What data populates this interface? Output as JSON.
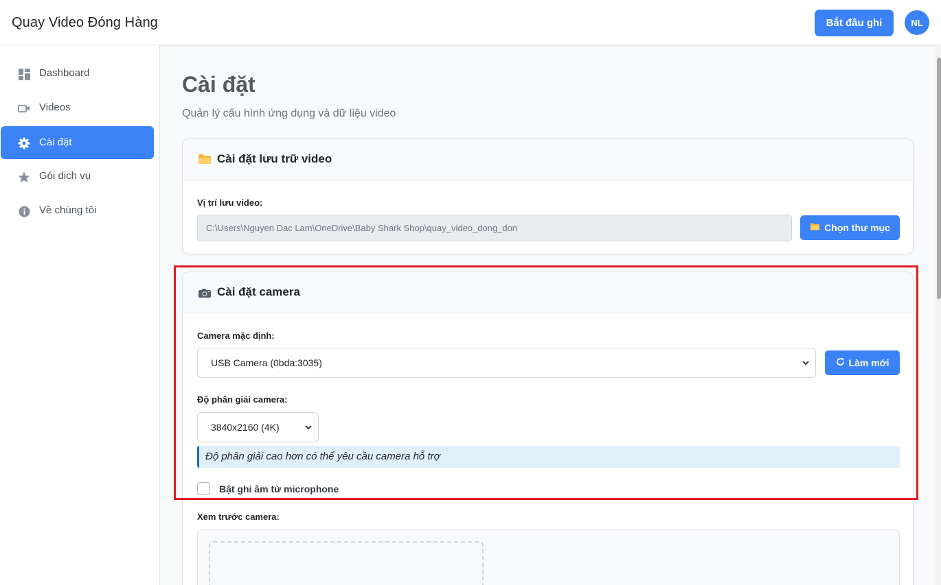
{
  "header": {
    "app_title": "Quay Video Đóng Hàng",
    "record_button": "Bắt đầu ghi",
    "avatar_initials": "NL"
  },
  "sidebar": {
    "items": [
      {
        "label": "Dashboard",
        "icon": "dashboard-icon",
        "active": false
      },
      {
        "label": "Videos",
        "icon": "video-camera-icon",
        "active": false
      },
      {
        "label": "Cài đặt",
        "icon": "gear-icon",
        "active": true
      },
      {
        "label": "Gói dịch vụ",
        "icon": "star-icon",
        "active": false
      },
      {
        "label": "Về chúng tôi",
        "icon": "info-icon",
        "active": false
      }
    ]
  },
  "main": {
    "title": "Cài đặt",
    "subtitle": "Quản lý cấu hình ứng dụng và dữ liệu video",
    "storage_card": {
      "icon": "folder-icon",
      "title": "Cài đặt lưu trữ video",
      "path_label": "Vị trí lưu video:",
      "path_value": "C:\\Users\\Nguyen Dac Lam\\OneDrive\\Baby Shark Shop\\quay_video_dong_don",
      "choose_button": "Chọn thư mục"
    },
    "camera_card": {
      "icon": "camera-icon",
      "title": "Cài đặt camera",
      "camera_label": "Camera mặc định:",
      "camera_selected": "USB Camera (0bda:3035)",
      "refresh_button": "Làm mới",
      "resolution_label": "Độ phân giải camera:",
      "resolution_selected": "3840x2160 (4K)",
      "resolution_note": "Độ phân giải cao hơn có thể yêu cầu camera hỗ trợ",
      "mic_checkbox_label": "Bật ghi âm từ microphone",
      "mic_checked": false,
      "preview_label": "Xem trước camera:"
    }
  },
  "colors": {
    "accent": "#3b82f6",
    "highlight": "#e01b24",
    "info_bg": "#e0f0fb"
  }
}
